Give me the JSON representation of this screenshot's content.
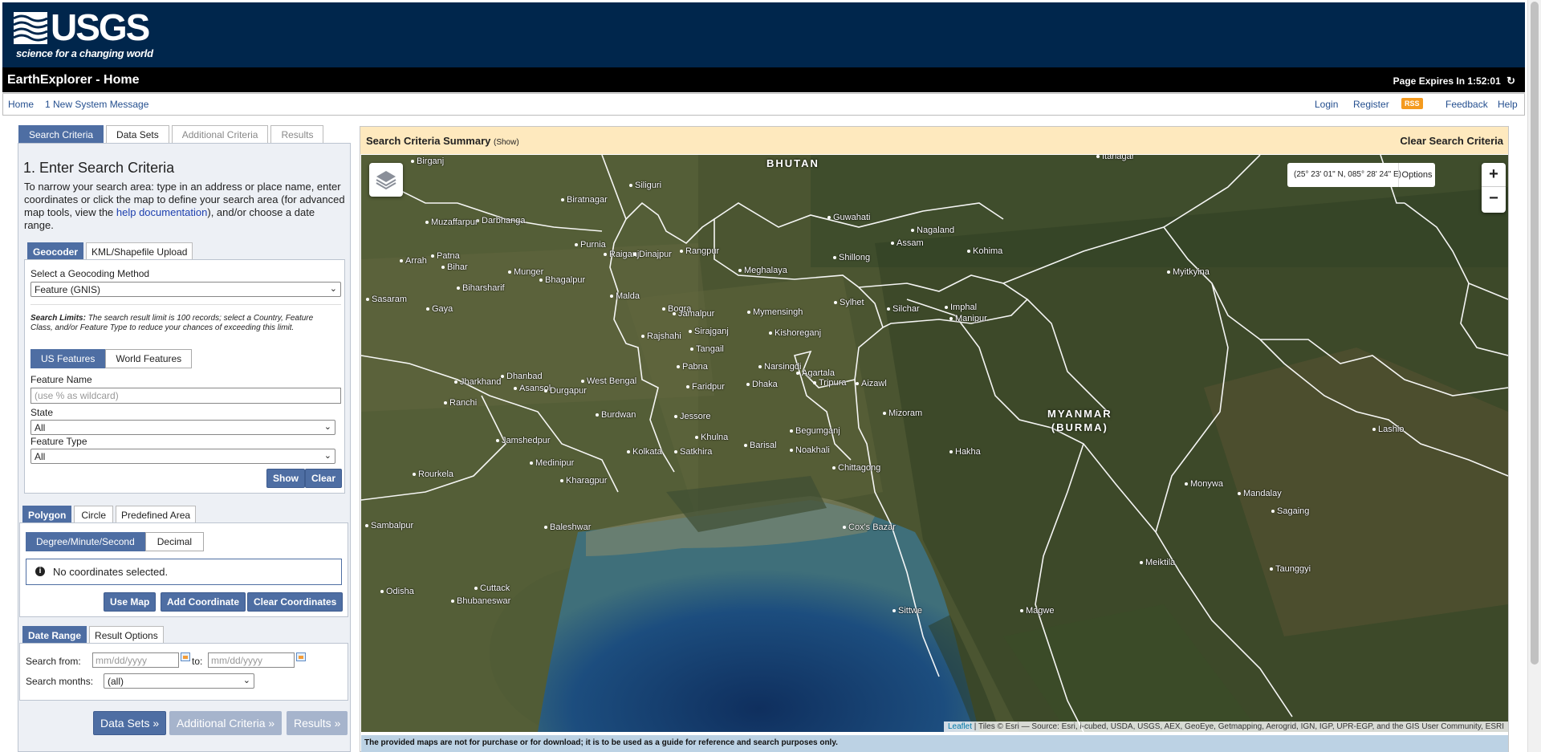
{
  "header": {
    "logo_text": "USGS",
    "logo_tagline": "science for a changing world",
    "app_title": "EarthExplorer - Home",
    "expires": "Page Expires In 1:52:01"
  },
  "nav": {
    "home": "Home",
    "message": "1 New System Message",
    "login": "Login",
    "register": "Register",
    "rss": "RSS",
    "feedback": "Feedback",
    "help": "Help"
  },
  "main_tabs": [
    "Search Criteria",
    "Data Sets",
    "Additional Criteria",
    "Results"
  ],
  "criteria": {
    "heading": "1. Enter Search Criteria",
    "intro_pre": "To narrow your search area: type in an address or place name, enter coordinates or click the map to define your search area (for advanced map tools, view the ",
    "intro_link": "help documentation",
    "intro_post": "), and/or choose a date range."
  },
  "geocoder": {
    "tabs": [
      "Geocoder",
      "KML/Shapefile Upload"
    ],
    "method_label": "Select a Geocoding Method",
    "method_value": "Feature (GNIS)",
    "limits_title": "Search Limits:",
    "limits_text": "The search result limit is 100 records; select a Country, Feature Class, and/or Feature Type to reduce your chances of exceeding this limit.",
    "feature_toggle": [
      "US Features",
      "World Features"
    ],
    "feature_name_label": "Feature Name",
    "feature_name_placeholder": "(use % as wildcard)",
    "state_label": "State",
    "state_value": "All",
    "type_label": "Feature Type",
    "type_value": "All",
    "show": "Show",
    "clear": "Clear"
  },
  "area": {
    "tabs": [
      "Polygon",
      "Circle",
      "Predefined Area"
    ],
    "format_toggle": [
      "Degree/Minute/Second",
      "Decimal"
    ],
    "notice": "No coordinates selected.",
    "use_map": "Use Map",
    "add_coord": "Add Coordinate",
    "clear_coords": "Clear Coordinates"
  },
  "date": {
    "tabs": [
      "Date Range",
      "Result Options"
    ],
    "from_label": "Search from:",
    "from_placeholder": "mm/dd/yyyy",
    "to_label": "to:",
    "to_placeholder": "mm/dd/yyyy",
    "months_label": "Search months:",
    "months_value": "(all)"
  },
  "bottom_buttons": [
    "Data Sets »",
    "Additional Criteria »",
    "Results »"
  ],
  "map": {
    "summary_title": "Search Criteria Summary",
    "summary_show": "(Show)",
    "clear": "Clear Search Criteria",
    "coords": "(25° 23' 01\" N, 085° 28' 24\" E)",
    "options": "Options",
    "zoom_in": "+",
    "zoom_out": "−",
    "attrib_link": "Leaflet",
    "attrib_text": " | Tiles © Esri — Source: Esri, i-cubed, USDA, USGS, AEX, GeoEye, Getmapping, Aerogrid, IGN, IGP, UPR-EGP, and the GIS User Community, ESRI",
    "disclaimer": "The provided maps are not for purchase or for download; it is to be used as a guide for reference and search purposes only.",
    "countries": [
      "BHUTAN",
      "MYANMAR\n(BURMA)"
    ],
    "cities": [
      "Birganj",
      "Biratnagar",
      "Siliguri",
      "Darbhanga",
      "Muzaffarpur",
      "Patna",
      "Bihar",
      "Arrah",
      "Munger",
      "Bhagalpur",
      "Biharsharif",
      "Sasaram",
      "Gaya",
      "Purnia",
      "Raiganj",
      "Dinajpur",
      "Rangpur",
      "Guwahati",
      "Shillong",
      "Meghalaya",
      "Assam",
      "Nagaland",
      "Kohima",
      "Myitkyina",
      "Imphal",
      "Manipur",
      "Silchar",
      "Sylhet",
      "Mymensingh",
      "Kishoreganj",
      "Bogra",
      "Jamalpur",
      "Sirajganj",
      "Tangail",
      "Malda",
      "Rajshahi",
      "Pabna",
      "Narsingdi",
      "Dhaka",
      "Faridpur",
      "Agartala",
      "Tripura",
      "Aizawl",
      "Mizoram",
      "Dhanbad",
      "Jharkhand",
      "Asansol",
      "Durgapur",
      "West Bengal",
      "Ranchi",
      "Burdwan",
      "Jessore",
      "Khulna",
      "Barisal",
      "Begumganj",
      "Noakhali",
      "Chittagong",
      "Jamshedpur",
      "Kolkata",
      "Satkhira",
      "Medinipur",
      "Kharagpur",
      "Rourkela",
      "Sambalpur",
      "Baleshwar",
      "Cox's Bazar",
      "Hakha",
      "Lashio",
      "Monywa",
      "Mandalay",
      "Sagaing",
      "Meiktila",
      "Taunggyi",
      "Cuttack",
      "Bhubaneswar",
      "Odisha",
      "Sittwe",
      "Magwe",
      "Itanagar"
    ]
  }
}
